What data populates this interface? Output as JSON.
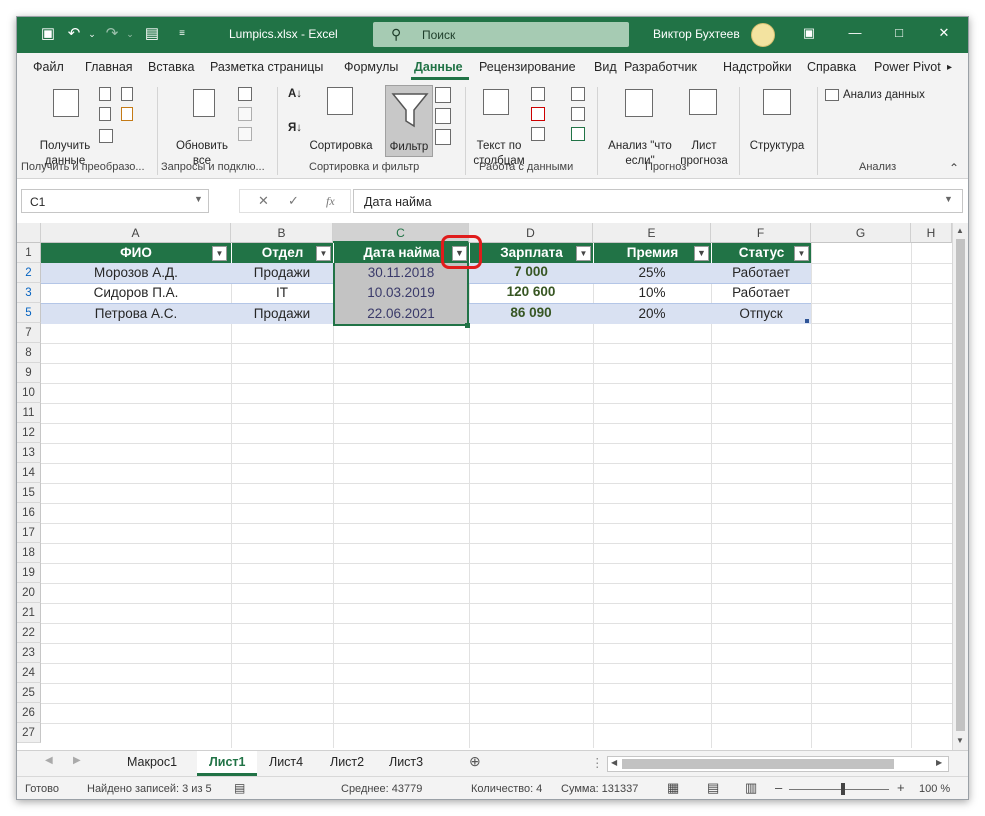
{
  "titlebar": {
    "filename": "Lumpics.xlsx",
    "sep": " - ",
    "app": "Excel",
    "search_placeholder": "Поиск",
    "user": "Виктор Бухтеев"
  },
  "ribbon_tabs": [
    "Файл",
    "Главная",
    "Вставка",
    "Разметка страницы",
    "Формулы",
    "Данные",
    "Рецензирование",
    "Вид",
    "Разработчик",
    "Надстройки",
    "Справка",
    "Power Pivot"
  ],
  "ribbon": {
    "get_data": "Получить данные",
    "refresh_all": "Обновить все",
    "sort": "Сортировка",
    "filter": "Фильтр",
    "text_to_columns": "Текст по столбцам",
    "what_if": "Анализ \"что если\"",
    "forecast_sheet": "Лист прогноза",
    "structure": "Структура",
    "data_analysis": "Анализ данных",
    "groups": [
      "Получить и преобразо...",
      "Запросы и подклю...",
      "Сортировка и фильтр",
      "Работа с данными",
      "Прогноз",
      "Анализ"
    ]
  },
  "formula_bar": {
    "name_box": "C1",
    "fx": "fx",
    "content": "Дата найма"
  },
  "columns": [
    "A",
    "B",
    "C",
    "D",
    "E",
    "F",
    "G",
    "H"
  ],
  "rows": [
    "1",
    "2",
    "3",
    "5",
    "7",
    "8",
    "9",
    "10",
    "11",
    "12",
    "13",
    "14",
    "15",
    "16",
    "17",
    "18",
    "19",
    "20",
    "21",
    "22",
    "23",
    "24",
    "25",
    "26",
    "27"
  ],
  "table": {
    "headers": [
      "ФИО",
      "Отдел",
      "Дата найма",
      "Зарплата",
      "Премия",
      "Статус"
    ],
    "data": [
      [
        "Морозов А.Д.",
        "Продажи",
        "30.11.2018",
        "7 000",
        "25%",
        "Работает"
      ],
      [
        "Сидоров П.А.",
        "IT",
        "10.03.2019",
        "120 600",
        "10%",
        "Работает"
      ],
      [
        "Петрова А.С.",
        "Продажи",
        "22.06.2021",
        "86 090",
        "20%",
        "Отпуск"
      ]
    ]
  },
  "sheet_tabs": [
    "Макрос1",
    "Лист1",
    "Лист4",
    "Лист2",
    "Лист3"
  ],
  "status": {
    "ready": "Готово",
    "found": "Найдено записей: 3 из 5",
    "average": "Среднее: 43779",
    "count": "Количество: 4",
    "sum": "Сумма: 131337",
    "zoom": "100 %"
  },
  "colors": {
    "brand": "#217346",
    "header_fill": "#217346",
    "band": "#d9e1f2",
    "highlight": "#e01c1c"
  }
}
